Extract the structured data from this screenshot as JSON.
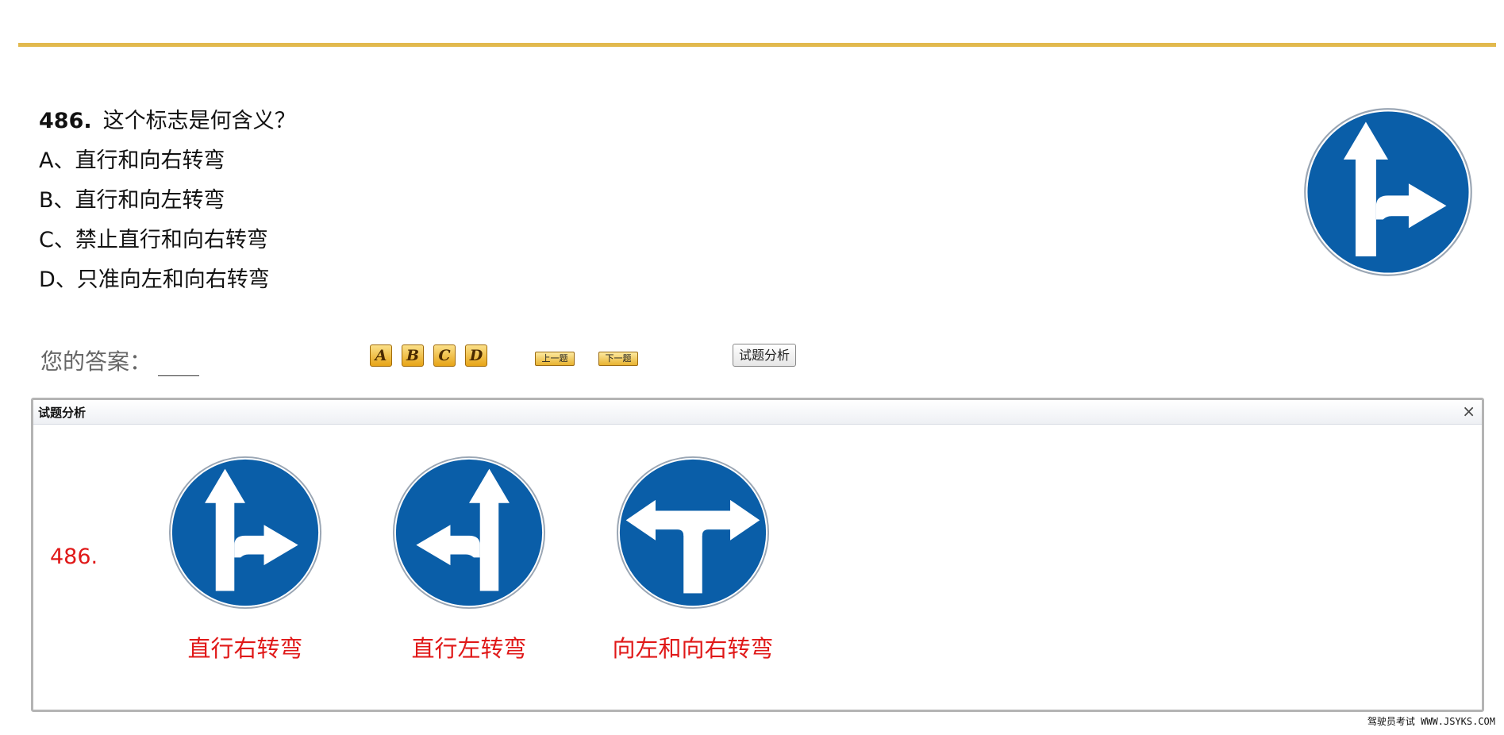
{
  "question": {
    "number": "486.",
    "text": "这个标志是何含义？",
    "options": [
      "A、直行和向右转弯",
      "B、直行和向左转弯",
      "C、禁止直行和向右转弯",
      "D、只准向左和向右转弯"
    ]
  },
  "answer": {
    "label": "您的答案："
  },
  "choices": [
    "A",
    "B",
    "C",
    "D"
  ],
  "nav": {
    "prev": "上一题",
    "next": "下一题"
  },
  "analysis_button": "试题分析",
  "panel": {
    "title": "试题分析",
    "close": "×",
    "number": "486.",
    "signs": [
      {
        "caption": "直行右转弯",
        "icon": "straight-right-sign-icon"
      },
      {
        "caption": "直行左转弯",
        "icon": "straight-left-sign-icon"
      },
      {
        "caption": "向左和向右转弯",
        "icon": "left-right-sign-icon"
      }
    ]
  },
  "footer": "驾驶员考试 WWW.JSYKS.COM",
  "colors": {
    "sign_blue": "#0a5ea8",
    "accent_rule": "#e2b94e",
    "caption_red": "#e01818"
  }
}
